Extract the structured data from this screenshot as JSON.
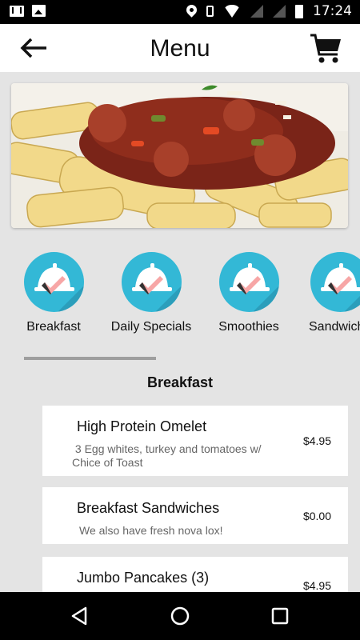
{
  "status_bar": {
    "time": "17:24",
    "icons": [
      "gmail-icon",
      "photo-icon",
      "location-icon",
      "vibrate-icon",
      "wifi-icon",
      "signal-icon",
      "signal-icon",
      "battery-icon"
    ]
  },
  "header": {
    "title": "Menu",
    "back_icon": "arrow-left-icon",
    "cart_icon": "shopping-cart-icon"
  },
  "hero": {
    "image": "pasta-dish-photo"
  },
  "categories": [
    {
      "label": "Breakfast",
      "icon": "cloche-check-icon"
    },
    {
      "label": "Daily Specials",
      "icon": "cloche-check-icon"
    },
    {
      "label": "Smoothies",
      "icon": "cloche-check-icon"
    },
    {
      "label": "Sandwiches",
      "icon": "cloche-check-icon"
    }
  ],
  "section": {
    "title": "Breakfast"
  },
  "items": [
    {
      "name": "High Protein Omelet",
      "description_line1": " 3 Egg whites, turkey and tomatoes w/",
      "description_line2": "Chice of Toast",
      "price": "$4.95"
    },
    {
      "name": "Breakfast Sandwiches",
      "description_line1": "We also have fresh nova lox!",
      "price": "$0.00"
    },
    {
      "name": "Jumbo Pancakes (3)",
      "price": "$4.95"
    }
  ],
  "nav": {
    "back": "triangle-back-icon",
    "home": "circle-home-icon",
    "recents": "square-recents-icon"
  },
  "colors": {
    "accent": "#33b8d6",
    "background": "#e4e4e4"
  }
}
